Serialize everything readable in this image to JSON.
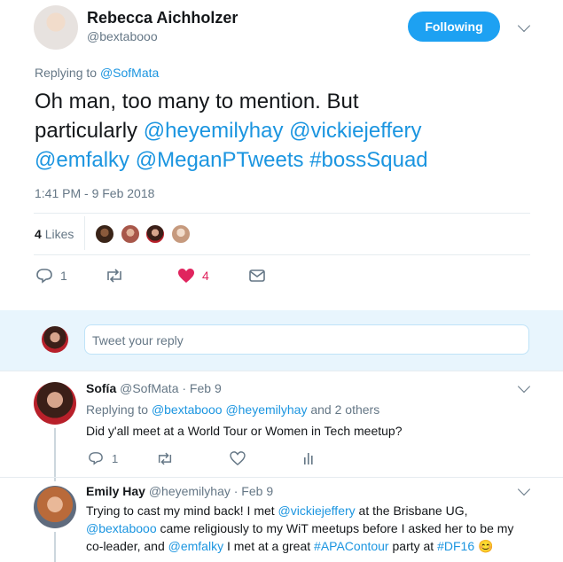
{
  "tweet": {
    "author_name": "Rebecca Aichholzer",
    "author_handle": "@bextabooo",
    "follow_label": "Following",
    "replying_prefix": "Replying to",
    "replying_to": "@SofMata",
    "text_plain_1": "Oh man, too many to mention. But",
    "text_plain_2": "particularly",
    "mention_1": "@heyemilyhay",
    "mention_2": "@vickiejeffery",
    "mention_3": "@emfalky",
    "mention_4": "@MeganPTweets",
    "hashtag": "#bossSquad",
    "timestamp": "1:41 PM - 9 Feb 2018",
    "likes_count": "4",
    "likes_label": "Likes",
    "action_reply_count": "1",
    "action_like_count": "4"
  },
  "reply_box": {
    "placeholder": "Tweet your reply"
  },
  "replies": [
    {
      "name": "Sofía",
      "handle": "@SofMata",
      "date": "· Feb 9",
      "replying_prefix": "Replying to",
      "replying_1": "@bextabooo",
      "replying_2": "@heyemilyhay",
      "replying_suffix": "and 2 others",
      "text": "Did y'all meet at a World Tour or Women in Tech meetup?",
      "reply_count": "1"
    },
    {
      "name": "Emily Hay",
      "handle": "@heyemilyhay",
      "date": "· Feb 9",
      "line1_a": "Trying to cast my mind back! I met",
      "line1_mention": "@vickiejeffery",
      "line1_b": "at the Brisbane UG,",
      "line2_mention": "@bextabooo",
      "line2_b": "came religiously to my WiT meetups before I asked her to be my",
      "line3_a": "co-leader, and",
      "line3_mention": "@emfalky",
      "line3_b": "I met at a great",
      "line3_tag1": "#APAContour",
      "line3_c": "party at",
      "line3_tag2": "#DF16",
      "line3_emoji": "😊"
    }
  ],
  "icons": [
    "chevron-down-icon",
    "reply-icon",
    "retweet-icon",
    "heart-icon",
    "direct-message-icon",
    "analytics-icon"
  ],
  "colors": {
    "accent": "#1da1f2",
    "link": "#1b95e0",
    "heart": "#e0245e",
    "muted": "#657786"
  }
}
